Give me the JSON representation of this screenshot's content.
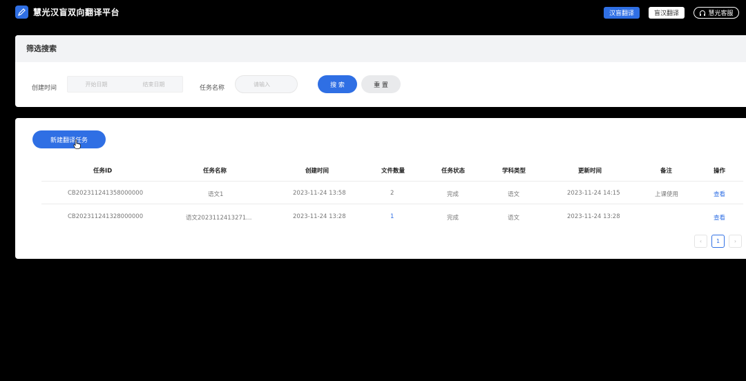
{
  "app": {
    "title": "慧光汉盲双向翻译平台"
  },
  "topnav": {
    "btn_hz": "汉盲翻译",
    "btn_zh": "盲汉翻译",
    "btn_service": "慧光客服"
  },
  "filter": {
    "title": "筛选搜索",
    "created_label": "创建时间",
    "start_placeholder": "开始日期",
    "end_placeholder": "结束日期",
    "name_label": "任务名称",
    "name_placeholder": "请输入",
    "search_label": "搜 索",
    "reset_label": "重 置"
  },
  "tasks": {
    "new_label": "新建翻译任务",
    "columns": [
      "任务ID",
      "任务名称",
      "创建时间",
      "文件数量",
      "任务状态",
      "学科类型",
      "更新时间",
      "备注",
      "操作"
    ],
    "rows": [
      [
        "CB202311241358000000",
        "语文1",
        "2023-11-24 13:58",
        "2",
        "完成",
        "语文",
        "2023-11-24 14:15",
        "上课使用",
        "查看"
      ],
      [
        "CB202311241328000000",
        "语文2023112413271...",
        "2023-11-24 13:28",
        "1",
        "完成",
        "语文",
        "2023-11-24 13:28",
        "",
        "查看"
      ]
    ]
  },
  "pager": {
    "prev": "‹",
    "current": "1",
    "next": "›"
  },
  "colors": {
    "accent": "#2f6fe4",
    "background": "#000000",
    "panel": "#ffffff",
    "panel_header": "#f2f3f5"
  },
  "icons": {
    "logo": "pen-icon",
    "service": "headset-icon",
    "cursor": "hand-pointer-icon"
  }
}
